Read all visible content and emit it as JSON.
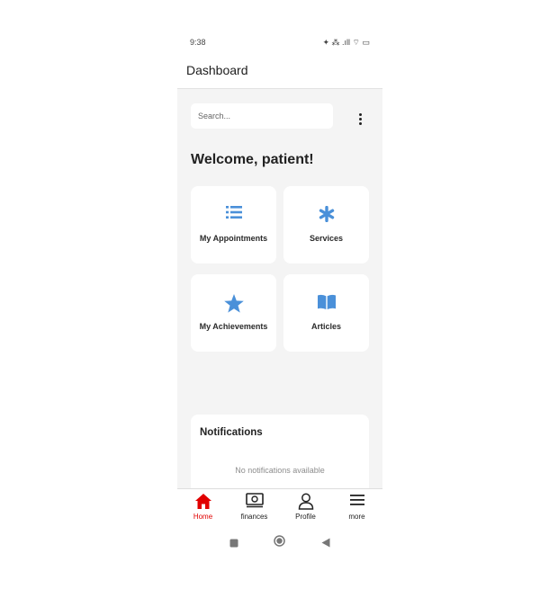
{
  "status_bar": {
    "time": "9:38",
    "icons": "✦ ⁂ .ıll ⌔ ▭"
  },
  "header": {
    "title": "Dashboard"
  },
  "search": {
    "placeholder": "Search..."
  },
  "welcome": "Welcome, patient!",
  "tiles": [
    {
      "label": "My Appointments",
      "icon": "list-icon"
    },
    {
      "label": "Services",
      "icon": "asterisk-icon"
    },
    {
      "label": "My Achievements",
      "icon": "star-icon"
    },
    {
      "label": "Articles",
      "icon": "book-icon"
    }
  ],
  "notifications": {
    "title": "Notifications",
    "empty_text": "No notifications available"
  },
  "bottom_nav": [
    {
      "label": "Home",
      "icon": "home-icon",
      "active": true
    },
    {
      "label": "finances",
      "icon": "money-icon",
      "active": false
    },
    {
      "label": "Profile",
      "icon": "person-icon",
      "active": false
    },
    {
      "label": "more",
      "icon": "menu-icon",
      "active": false
    }
  ],
  "colors": {
    "accent_blue": "#4a90d9",
    "active_red": "#e10000",
    "background": "#f4f4f4"
  }
}
